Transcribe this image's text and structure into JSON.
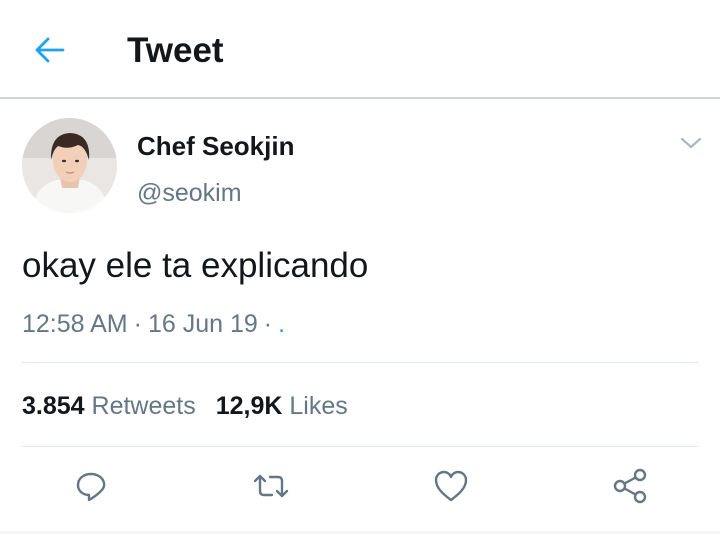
{
  "header": {
    "title": "Tweet",
    "back_icon": "arrow-left-icon"
  },
  "tweet": {
    "author": {
      "name": "Chef Seokjin",
      "handle": "@seokim",
      "avatar": "profile-photo"
    },
    "text": "okay ele ta explicando",
    "time": "12:58 AM",
    "date": "16 Jun 19",
    "source": ".",
    "separator": "·",
    "stats": {
      "retweets_count": "3.854",
      "retweets_label": "Retweets",
      "likes_count": "12,9K",
      "likes_label": "Likes"
    },
    "actions": [
      "reply-icon",
      "retweet-icon",
      "like-icon",
      "share-icon"
    ]
  },
  "colors": {
    "accent": "#1da1f2",
    "text_primary": "#14171a",
    "text_secondary": "#657786",
    "divider": "#e1e8ed"
  }
}
